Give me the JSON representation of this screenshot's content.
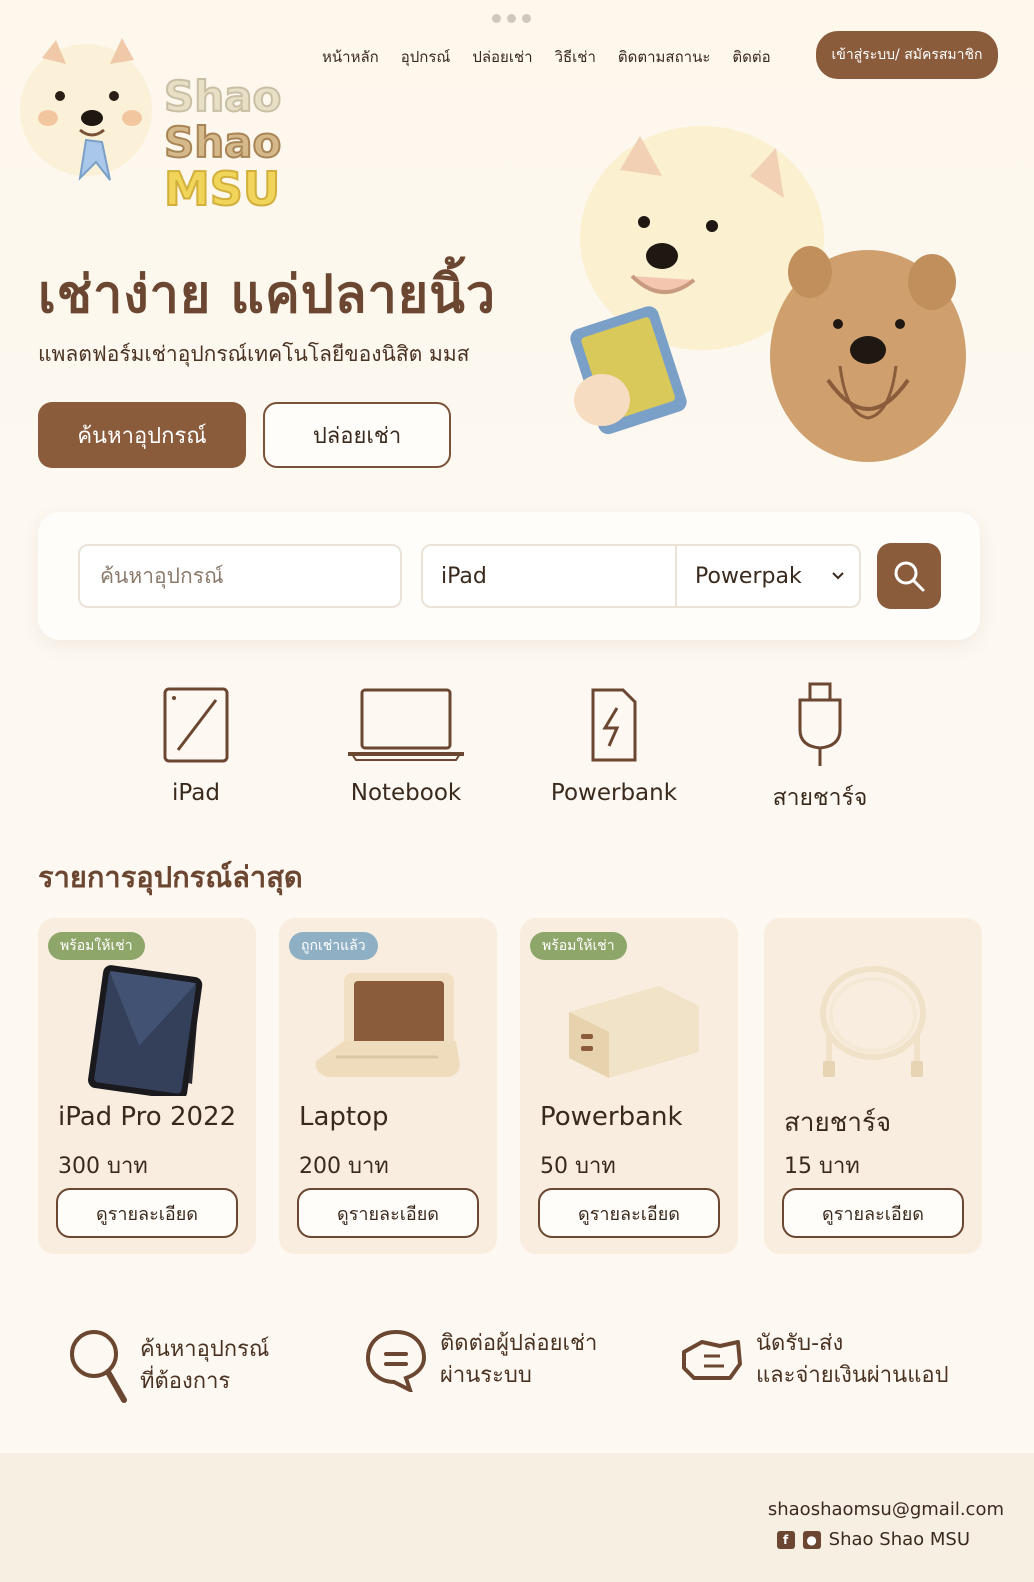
{
  "brand": {
    "line1": "Shao",
    "line2": "Shao",
    "line3": "MSU"
  },
  "nav": {
    "items": [
      "หน้าหลัก",
      "อุปกรณ์",
      "ปล่อยเช่า",
      "วิธีเช่า",
      "ติดตามสถานะ",
      "ติดต่อ"
    ],
    "login": "เข้าสู่ระบบ/ สมัครสมาชิก"
  },
  "hero": {
    "title": "เช่าง่าย แค่ปลายนิ้ว",
    "subtitle": "แพลตฟอร์มเช่าอุปกรณ์เทคโนโลยีของนิสิต มมส",
    "primary_button": "ค้นหาอุปกรณ์",
    "secondary_button": "ปล่อยเช่า"
  },
  "search": {
    "placeholder": "ค้นหาอุปกรณ์",
    "type_value": "iPad",
    "select_value": "Powerpak",
    "icon": "search-icon"
  },
  "categories": [
    {
      "label": "iPad",
      "icon": "tablet-icon"
    },
    {
      "label": "Notebook",
      "icon": "laptop-icon"
    },
    {
      "label": "Powerbank",
      "icon": "powerbank-icon"
    },
    {
      "label": "สายชาร์จ",
      "icon": "cable-icon"
    }
  ],
  "latest": {
    "title": "รายการอุปกรณ์ล่าสุด",
    "items": [
      {
        "badge": "พร้อมให้เช่า",
        "badge_color": "#8fa66a",
        "name": "iPad Pro 2022",
        "price": "300 บาท",
        "button": "ดูรายละเอียด"
      },
      {
        "badge": "ถูกเช่าแล้ว",
        "badge_color": "#8fb0c4",
        "name": "Laptop",
        "price": "200 บาท",
        "button": "ดูรายละเอียด"
      },
      {
        "badge": "พร้อมให้เช่า",
        "badge_color": "#8fa66a",
        "name": "Powerbank",
        "price": "50 บาท",
        "button": "ดูรายละเอียด"
      },
      {
        "badge": "",
        "badge_color": "",
        "name": "สายชาร์จ",
        "price": "15 บาท",
        "button": "ดูรายละเอียด"
      }
    ]
  },
  "features": [
    {
      "line1": "ค้นหาอุปกรณ์",
      "line2": "ที่ต้องการ",
      "icon": "magnifier-icon"
    },
    {
      "line1": "ติดต่อผู้ปล่อยเช่า",
      "line2": "ผ่านระบบ",
      "icon": "chat-icon"
    },
    {
      "line1": "นัดรับ-ส่ง",
      "line2": "และจ่ายเงินผ่านแอป",
      "icon": "handshake-icon"
    }
  ],
  "footer": {
    "email": "shaoshaomsu@gmail.com",
    "social_name": "Shao Shao MSU"
  },
  "colors": {
    "accent": "#8a5c3b",
    "text": "#3a2a1d",
    "bg": "#fdf8f0",
    "card": "#f9ede0"
  }
}
